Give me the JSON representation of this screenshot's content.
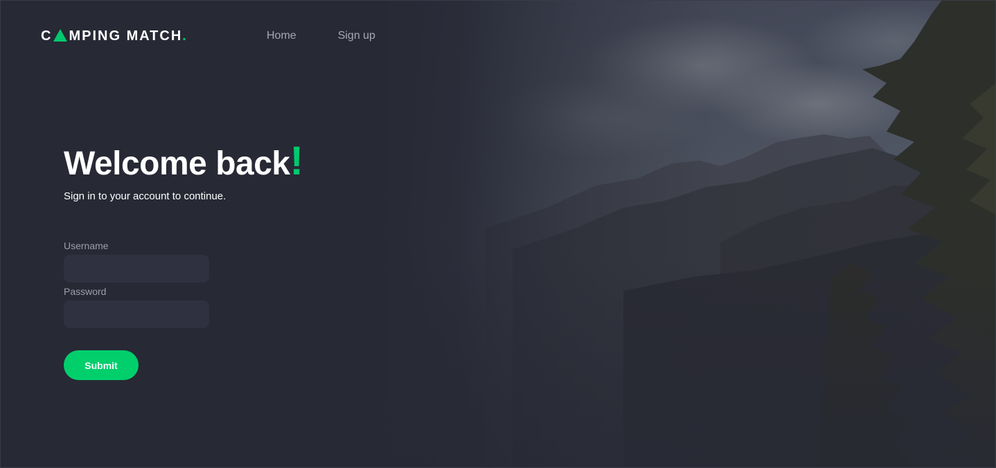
{
  "brand": {
    "name_before": "C",
    "name_after": "MPING MATCH",
    "dot": ".",
    "icon": "tent-triangle-icon",
    "accent_color": "#00c96e"
  },
  "nav": {
    "items": [
      {
        "label": "Home"
      },
      {
        "label": "Sign up"
      }
    ]
  },
  "hero": {
    "title": "Welcome back",
    "title_mark": "!",
    "subtitle": "Sign in to your account to continue."
  },
  "form": {
    "username_label": "Username",
    "username_value": "",
    "password_label": "Password",
    "password_value": "",
    "submit_label": "Submit"
  },
  "colors": {
    "background": "#272935",
    "input_background": "#2f3140",
    "button": "#00cf6c"
  }
}
